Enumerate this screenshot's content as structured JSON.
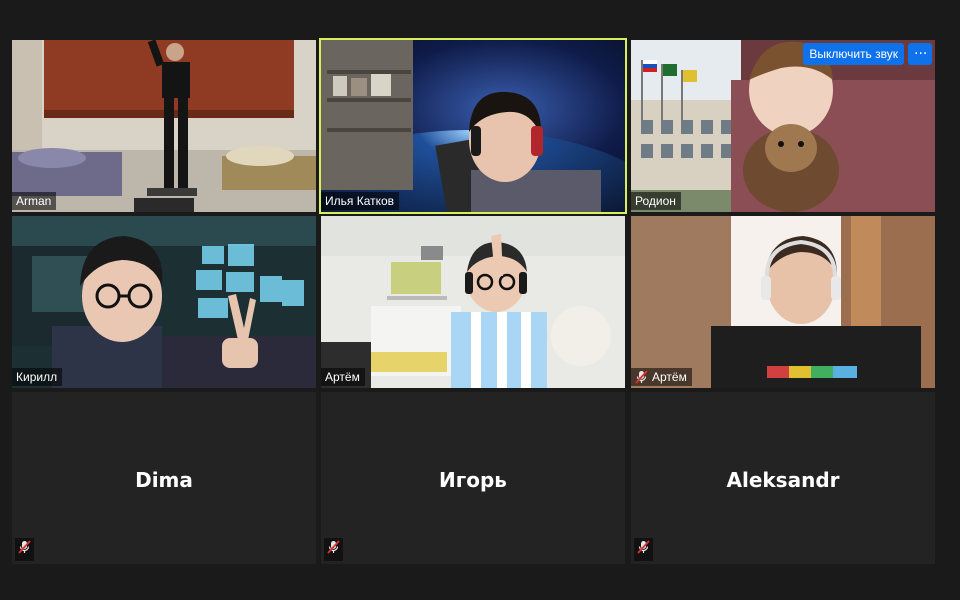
{
  "participants": [
    {
      "name": "Arman",
      "muted": false
    },
    {
      "name": "Илья Катков",
      "muted": false,
      "active_speaker": true
    },
    {
      "name": "Родион",
      "muted": false
    },
    {
      "name": "Кирилл",
      "muted": false
    },
    {
      "name": "Артём",
      "muted": false
    },
    {
      "name": "Артём",
      "muted": true
    },
    {
      "name": "Dima",
      "muted": true,
      "video_off": true
    },
    {
      "name": "Игорь",
      "muted": true,
      "video_off": true
    },
    {
      "name": "Aleksandr",
      "muted": true,
      "video_off": true
    }
  ],
  "controls": {
    "mute_label": "Выключить звук",
    "more_label": "···"
  },
  "colors": {
    "active_speaker_border": "#d6ef5a",
    "button_blue": "#0e72ed",
    "muted_red": "#e02f2f",
    "tile_background": "#232323"
  }
}
